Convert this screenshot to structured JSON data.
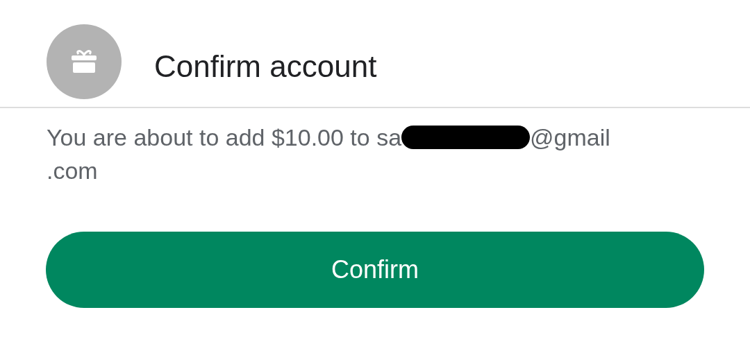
{
  "dialog": {
    "title": "Confirm account",
    "message": [
      {
        "kind": "text",
        "text": "You are about to add $10.00 to sa"
      },
      {
        "kind": "redaction"
      },
      {
        "kind": "text",
        "text": "@gmail"
      },
      {
        "kind": "break"
      },
      {
        "kind": "text",
        "text": ".com"
      }
    ],
    "button": "Confirm"
  }
}
